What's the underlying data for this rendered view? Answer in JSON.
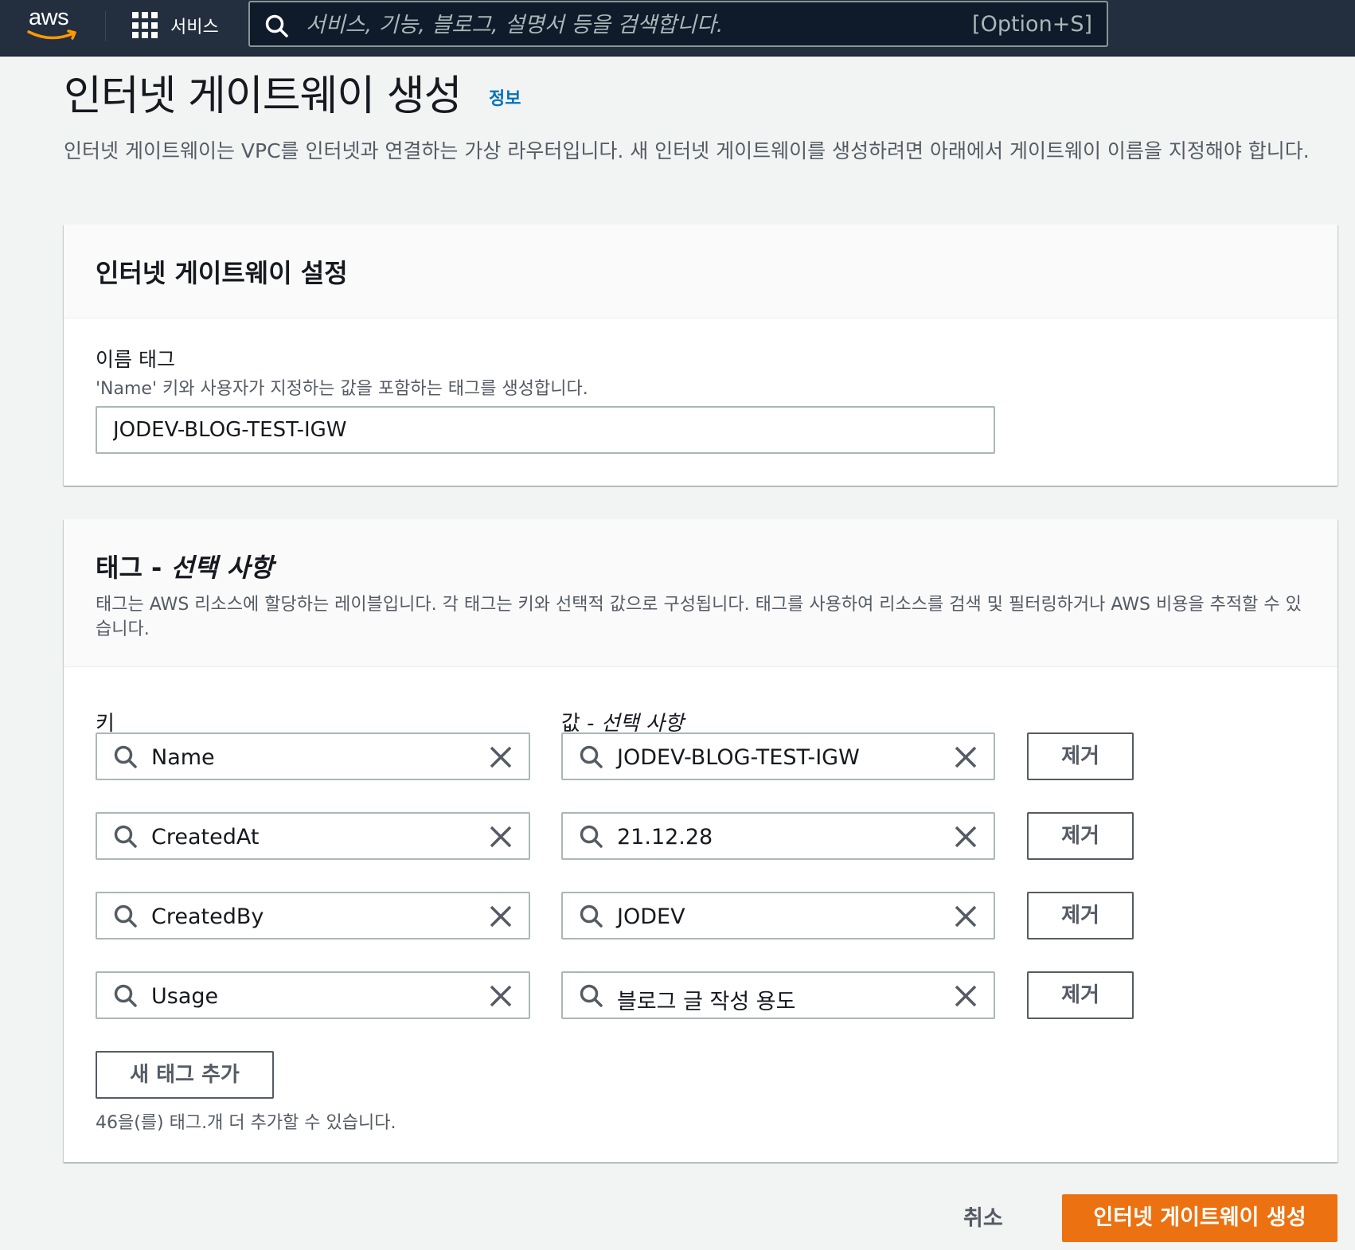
{
  "nav": {
    "logo_text": "aws",
    "services_label": "서비스",
    "search_placeholder": "서비스, 기능, 블로그, 설명서 등을 검색합니다.",
    "search_shortcut": "[Option+S]"
  },
  "page": {
    "title": "인터넷 게이트웨이 생성",
    "info_link": "정보",
    "description": "인터넷 게이트웨이는 VPC를 인터넷과 연결하는 가상 라우터입니다. 새 인터넷 게이트웨이를 생성하려면 아래에서 게이트웨이 이름을 지정해야 합니다."
  },
  "settings_panel": {
    "title": "인터넷 게이트웨이 설정",
    "name_tag_label": "이름 태그",
    "name_tag_desc": "'Name' 키와 사용자가 지정하는 값을 포함하는 태그를 생성합니다.",
    "name_tag_value": "JODEV-BLOG-TEST-IGW"
  },
  "tags_panel": {
    "title_main": "태그 - ",
    "title_optional": "선택 사항",
    "description": "태그는 AWS 리소스에 할당하는 레이블입니다. 각 태그는 키와 선택적 값으로 구성됩니다. 태그를 사용하여 리소스를 검색 및 필터링하거나 AWS 비용을 추적할 수 있습니다.",
    "key_header": "키",
    "value_header_main": "값 - ",
    "value_header_optional": "선택 사항",
    "rows": [
      {
        "key": "Name",
        "value": "JODEV-BLOG-TEST-IGW",
        "remove_label": "제거"
      },
      {
        "key": "CreatedAt",
        "value": "21.12.28",
        "remove_label": "제거"
      },
      {
        "key": "CreatedBy",
        "value": "JODEV",
        "remove_label": "제거"
      },
      {
        "key": "Usage",
        "value": "블로그 글 작성 용도",
        "remove_label": "제거"
      }
    ],
    "add_tag_label": "새 태그 추가",
    "add_tag_hint": "46을(를) 태그.개 더 추가할 수 있습니다."
  },
  "footer": {
    "cancel_label": "취소",
    "create_label": "인터넷 게이트웨이 생성"
  },
  "colors": {
    "nav_bg": "#232f3e",
    "primary_button": "#ec7211",
    "link": "#0073bb",
    "logo_smile": "#ff9900"
  }
}
